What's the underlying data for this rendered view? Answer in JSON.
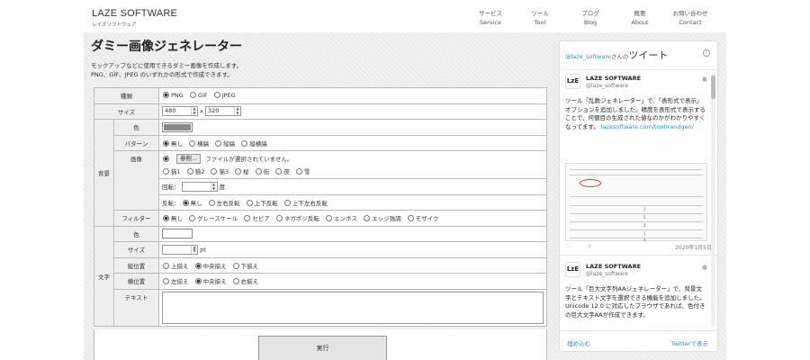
{
  "header": {
    "logo": "LAZE SOFTWARE",
    "logo_sub": "レイズソフトウェア",
    "nav": [
      {
        "jp": "サービス",
        "en": "Service"
      },
      {
        "jp": "ツール",
        "en": "Tool"
      },
      {
        "jp": "ブログ",
        "en": "Blog"
      },
      {
        "jp": "概要",
        "en": "About"
      },
      {
        "jp": "お問い合わせ",
        "en": "Contact"
      }
    ]
  },
  "main": {
    "title": "ダミー画像ジェネレーター",
    "desc1": "モックアップなどに使用できるダミー画像を作成します。",
    "desc2": "PNG、GIF、JPEG のいずれかの形式で作成できます。"
  },
  "form": {
    "type_label": "種類",
    "type_options": [
      "PNG",
      "GIF",
      "JPEG"
    ],
    "size_label": "サイズ",
    "width": "480",
    "size_x": "x",
    "height": "320",
    "bg_label": "背景",
    "color_label": "色",
    "pattern_label": "パターン",
    "pattern_options": [
      "無し",
      "横縞",
      "縦縞",
      "縦横縞"
    ],
    "image_label": "画像",
    "browse_label": "参照...",
    "no_file": "ファイルが選択されていません。",
    "stock_options": [
      "猫1",
      "猫2",
      "猫3",
      "桜",
      "街",
      "夜",
      "雪"
    ],
    "rotate_label": "回転：",
    "rotate_unit": "度",
    "flip_label": "反転：",
    "flip_options": [
      "無し",
      "左右反転",
      "上下反転",
      "上下左右反転"
    ],
    "filter_label": "フィルター",
    "filter_options": [
      "無し",
      "グレースケール",
      "セピア",
      "ネガポジ反転",
      "エンボス",
      "エッジ強調",
      "モザイク"
    ],
    "text_group_label": "文字",
    "text_color_label": "色",
    "text_size_label": "サイズ",
    "text_size_unit": "pt",
    "valign_label": "縦位置",
    "valign_options": [
      "上揃え",
      "中央揃え",
      "下揃え"
    ],
    "halign_label": "横位置",
    "halign_options": [
      "左揃え",
      "中央揃え",
      "右揃え"
    ],
    "text_label": "テキスト",
    "submit_label": "実行"
  },
  "twitter": {
    "handle_prefix": "@laze_software",
    "handle_suffix": "さんの",
    "heading": "ツイート",
    "info": "i",
    "avatar_text": "LzE",
    "tweets": [
      {
        "name": "LAZE SOFTWARE",
        "handle": "@laze_software",
        "body": "ツール「乱数ジェネレーター」で、「表形式で表示」オプションを追加しました。精度を表形式で表示することで、何個目の生成された値なのかがわかりやすくなってます。",
        "link": "lazesoftware.com/tool/randgen/",
        "date": "2020年1月5日",
        "image_numbers": [
          "2",
          "5",
          "4",
          "1",
          "4"
        ]
      },
      {
        "name": "LAZE SOFTWARE",
        "handle": "@laze_software",
        "body": "ツール「巨大文字列AAジェネレーター」で、背景文字とテキスト文字を選択できる機能を追加しました。Unicode 12.0 に対応したブラウザであれば、色付きの巨大文字AAが作成できます。"
      }
    ],
    "embed": "埋め込む",
    "view": "Twitterで表示"
  }
}
